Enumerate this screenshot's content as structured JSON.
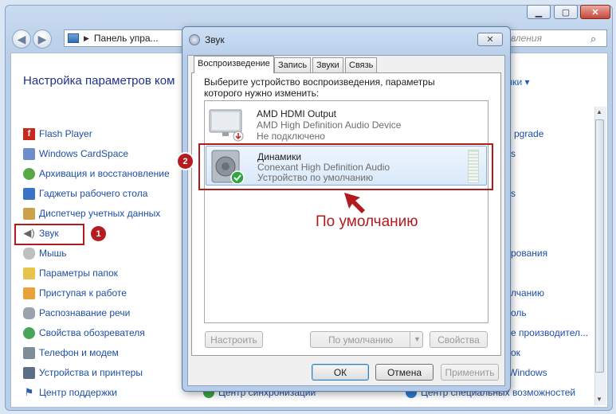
{
  "control_panel": {
    "address_text": "Панель упра...",
    "search_placeholder": "вления",
    "header_title": "Настройка параметров ком",
    "view_link": "чки ▾",
    "left_items": [
      {
        "label": "Flash Player",
        "icon": "flash-icon"
      },
      {
        "label": "Windows CardSpace",
        "icon": "cardspace-icon"
      },
      {
        "label": "Архивация и восстановление",
        "icon": "backup-icon"
      },
      {
        "label": "Гаджеты рабочего стола",
        "icon": "gadgets-icon"
      },
      {
        "label": "Диспетчер учетных данных",
        "icon": "credentials-icon"
      },
      {
        "label": "Звук",
        "icon": "speaker-icon"
      },
      {
        "label": "Мышь",
        "icon": "mouse-icon"
      },
      {
        "label": "Параметры папок",
        "icon": "folder-options-icon"
      },
      {
        "label": "Приступая к работе",
        "icon": "getting-started-icon"
      },
      {
        "label": "Распознавание речи",
        "icon": "microphone-icon"
      },
      {
        "label": "Свойства обозревателя",
        "icon": "internet-options-icon"
      },
      {
        "label": "Телефон и модем",
        "icon": "phone-modem-icon"
      },
      {
        "label": "Устройства и принтеры",
        "icon": "devices-printers-icon"
      },
      {
        "label": "Центр поддержки",
        "icon": "action-center-flag-icon"
      }
    ],
    "right_items": [
      "pgrade",
      "s",
      "s",
      "рования",
      "лчанию",
      "оль",
      "е производител...",
      "ок",
      "Windows"
    ],
    "bottom_items": {
      "sync_center": "Центр синхронизации",
      "ease_of_access": "Центр специальных возможностей"
    }
  },
  "dialog": {
    "title": "Звук",
    "tabs": [
      "Воспроизведение",
      "Запись",
      "Звуки",
      "Связь"
    ],
    "active_tab": "Воспроизведение",
    "instruction": "Выберите устройство воспроизведения, параметры которого нужно изменить:",
    "devices": [
      {
        "name": "AMD HDMI Output",
        "driver": "AMD High Definition Audio Device",
        "status": "Не подключено",
        "icon": "monitor-icon",
        "selected": false
      },
      {
        "name": "Динамики",
        "driver": "Conexant High Definition Audio",
        "status": "Устройство по умолчанию",
        "icon": "speaker-device-icon",
        "selected": true
      }
    ],
    "buttons": {
      "configure": "Настроить",
      "set_default": "По умолчанию",
      "properties": "Свойства",
      "ok": "ОК",
      "cancel": "Отмена",
      "apply": "Применить"
    }
  },
  "annotations": {
    "badge_1": "1",
    "badge_2": "2",
    "callout": "По умолчанию"
  },
  "colors": {
    "annotation_red": "#b21a1e",
    "link_blue": "#1e4fa6",
    "title_blue": "#1e3287",
    "selection_blue": "#d9e9fa"
  }
}
